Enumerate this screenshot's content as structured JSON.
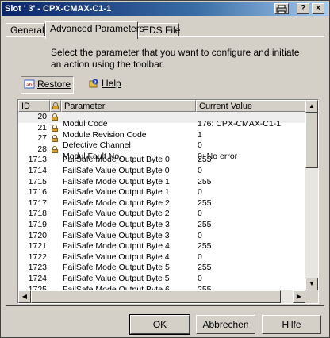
{
  "window": {
    "title": "Slot ' 3' - CPX-CMAX-C1-1",
    "print_icon": "printer-icon",
    "help_glyph": "?",
    "close_glyph": "×"
  },
  "tabs": [
    {
      "label": "General",
      "active": false
    },
    {
      "label": "Advanced Parameters",
      "active": true
    },
    {
      "label": "EDS File",
      "active": false
    }
  ],
  "intro_text": "Select the parameter that you want to configure and initiate an action using the toolbar.",
  "toolbar": {
    "restore_label": "Restore",
    "restore_icon": "restore-icon",
    "help_label": "Help",
    "help_icon": "help-icon"
  },
  "table": {
    "columns": [
      "ID",
      "",
      "Parameter",
      "Current Value"
    ],
    "header_icon": "lock-icon",
    "rows": [
      {
        "id": "20",
        "locked": true,
        "name": "Modul Code",
        "value": "176: CPX-CMAX-C1-1",
        "selected": true
      },
      {
        "id": "21",
        "locked": true,
        "name": "Module Revision Code",
        "value": "1"
      },
      {
        "id": "27",
        "locked": true,
        "name": "Defective Channel",
        "value": "0"
      },
      {
        "id": "28",
        "locked": true,
        "name": "Modul Fault No.",
        "value": "0: No error"
      },
      {
        "id": "1713",
        "locked": false,
        "name": "FailSafe Mode Output Byte 0",
        "value": "255"
      },
      {
        "id": "1714",
        "locked": false,
        "name": "FailSafe Value Output Byte 0",
        "value": "0"
      },
      {
        "id": "1715",
        "locked": false,
        "name": "FailSafe Mode Output Byte 1",
        "value": "255"
      },
      {
        "id": "1716",
        "locked": false,
        "name": "FailSafe Value Output Byte 1",
        "value": "0"
      },
      {
        "id": "1717",
        "locked": false,
        "name": "FailSafe Mode Output Byte 2",
        "value": "255"
      },
      {
        "id": "1718",
        "locked": false,
        "name": "FailSafe Value Output Byte 2",
        "value": "0"
      },
      {
        "id": "1719",
        "locked": false,
        "name": "FailSafe Mode Output Byte 3",
        "value": "255"
      },
      {
        "id": "1720",
        "locked": false,
        "name": "FailSafe Value Output Byte 3",
        "value": "0"
      },
      {
        "id": "1721",
        "locked": false,
        "name": "FailSafe Mode Output Byte 4",
        "value": "255"
      },
      {
        "id": "1722",
        "locked": false,
        "name": "FailSafe Value Output Byte 4",
        "value": "0"
      },
      {
        "id": "1723",
        "locked": false,
        "name": "FailSafe Mode Output Byte 5",
        "value": "255"
      },
      {
        "id": "1724",
        "locked": false,
        "name": "FailSafe Value Output Byte 5",
        "value": "0"
      },
      {
        "id": "1725",
        "locked": false,
        "name": "FailSafe Mode Output Byte 6",
        "value": "255"
      }
    ]
  },
  "buttons": {
    "ok": "OK",
    "cancel": "Abbrechen",
    "help": "Hilfe"
  },
  "colors": {
    "titlebar_start": "#0a246a",
    "titlebar_end": "#a6caf0",
    "dialog_bg": "#d4d0c8",
    "lock": "#d8a020"
  }
}
